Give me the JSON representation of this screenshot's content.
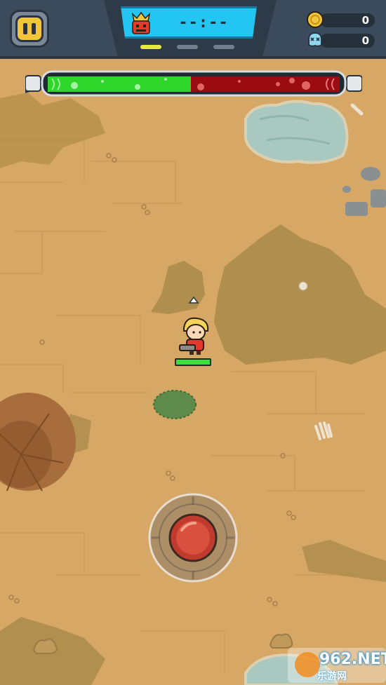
{
  "hud": {
    "timer": "--:--",
    "wave_dots": [
      {
        "state": "active"
      },
      {
        "state": "inactive"
      },
      {
        "state": "inactive"
      }
    ],
    "coins": "0",
    "kills": "0"
  },
  "boss_bar": {
    "player_fraction": 0.49,
    "boss_fraction": 0.51
  },
  "player": {
    "hp_fraction": 1.0
  },
  "watermark": {
    "brand": "962.NET",
    "sub": "乐游网"
  },
  "colors": {
    "ground": "#d6a765",
    "hud_bg": "#3c4b5b",
    "timer_bg": "#23c6f2",
    "player_bar": "#3de03a",
    "boss_bar": "#9a0c12",
    "coin": "#f2c53a"
  },
  "icons": {
    "pause": "pause-icon",
    "boss": "boss-crown-icon",
    "coin": "coin-icon",
    "kills": "skull-icon"
  }
}
